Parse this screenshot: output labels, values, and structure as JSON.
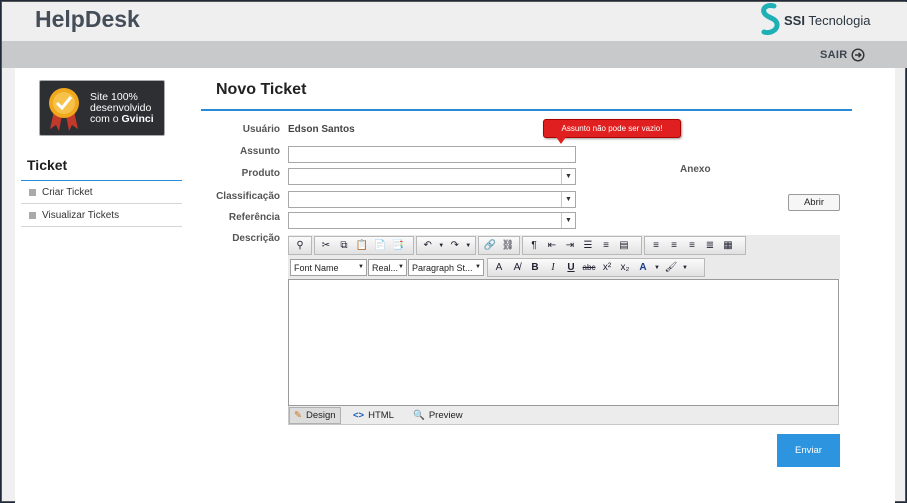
{
  "header": {
    "brand": "HelpDesk",
    "logo_text_bold": "SSI",
    "logo_text": " Tecnologia",
    "logout_label": "SAIR",
    "logout_icon": "arrow-circle-right-icon"
  },
  "sidebar": {
    "badge_lines": [
      "Site 100%",
      "desenvolvido",
      "com o "
    ],
    "badge_bold": "Gvinci",
    "title": "Ticket",
    "items": [
      {
        "label": "Criar Ticket"
      },
      {
        "label": "Visualizar Tickets"
      }
    ]
  },
  "form": {
    "title": "Novo Ticket",
    "usuario_label": "Usuário",
    "usuario_value": "Edson Santos",
    "assunto_label": "Assunto",
    "assunto_value": "",
    "produto_label": "Produto",
    "classificacao_label": "Classificação",
    "referencia_label": "Referência",
    "descricao_label": "Descrição",
    "error_tooltip": "Assunto não pode ser vazio!",
    "anexo_label": "Anexo",
    "abrir_label": "Abrir",
    "submit_label": "Enviar"
  },
  "editor": {
    "font_name": "Font Name",
    "font_size": "Real...",
    "paragraph_style": "Paragraph St...",
    "modes": [
      {
        "label": "Design",
        "icon": "pencil-icon",
        "active": true
      },
      {
        "label": "HTML",
        "icon": "code-icon",
        "active": false
      },
      {
        "label": "Preview",
        "icon": "magnifier-icon",
        "active": false
      }
    ]
  },
  "colors": {
    "accent": "#2b8ad6",
    "error": "#e02020",
    "submit": "#2d95e0"
  }
}
